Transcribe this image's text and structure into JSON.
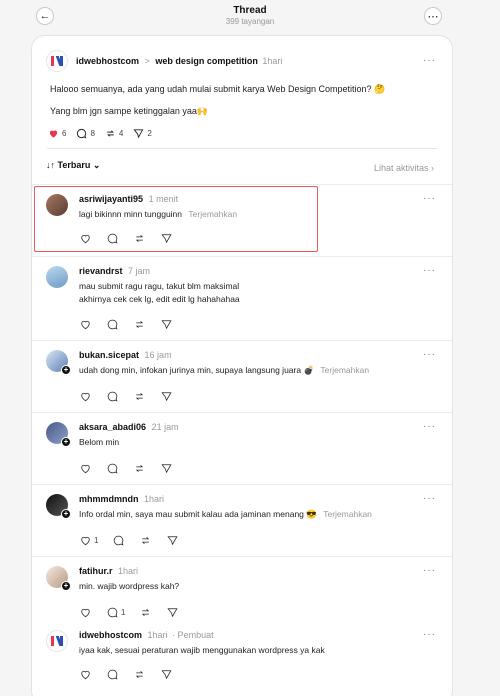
{
  "header": {
    "title": "Thread",
    "subtitle": "399 tayangan",
    "back_icon": "arrow-left-icon",
    "more_icon": "more-icon"
  },
  "post": {
    "author": "idwebhostcom",
    "separator": ">",
    "community": "web design competition",
    "time": "1hari",
    "line1": "Halooo semuanya, ada yang udah mulai submit karya Web Design Competition? 🤔",
    "line2": "Yang blm jgn sampe ketinggalan yaa🙌",
    "stats": {
      "likes": "6",
      "comments": "8",
      "reposts": "4",
      "shares": "2"
    },
    "like_color": "#e8364f"
  },
  "sort": {
    "label": "↓↑ Terbaru ⌄",
    "activity": "Lihat aktivitas ›"
  },
  "comments": [
    {
      "user": "asriwijayanti95",
      "time": "1 menit",
      "text": "lagi bikinnn minn tungguinn",
      "translate": "Terjemahkan",
      "likes": ""
    },
    {
      "user": "rievandrst",
      "time": "7 jam",
      "text": "mau submit ragu ragu, takut blm maksimal",
      "text2": "akhirnya cek cek lg, edit edit lg hahahahaa",
      "likes": ""
    },
    {
      "user": "bukan.sicepat",
      "time": "16 jam",
      "text": "udah dong min, infokan jurinya min, supaya langsung juara 💣",
      "translate": "Terjemahkan",
      "likes": ""
    },
    {
      "user": "aksara_abadi06",
      "time": "21 jam",
      "text": "Belom min",
      "likes": ""
    },
    {
      "user": "mhmmdmndn",
      "time": "1hari",
      "text": "Info ordal min, saya mau submit kalau ada jaminan menang 😎",
      "translate": "Terjemahkan",
      "likes": "1"
    },
    {
      "user": "fatihur.r",
      "time": "1hari",
      "text": "min. wajib wordpress kah?",
      "comments": "1"
    },
    {
      "user": "idwebhostcom",
      "time": "1hari",
      "by": "· Pembuat",
      "text": "iyaa kak, sesuai peraturan wajib menggunakan wordpress ya kak"
    }
  ]
}
